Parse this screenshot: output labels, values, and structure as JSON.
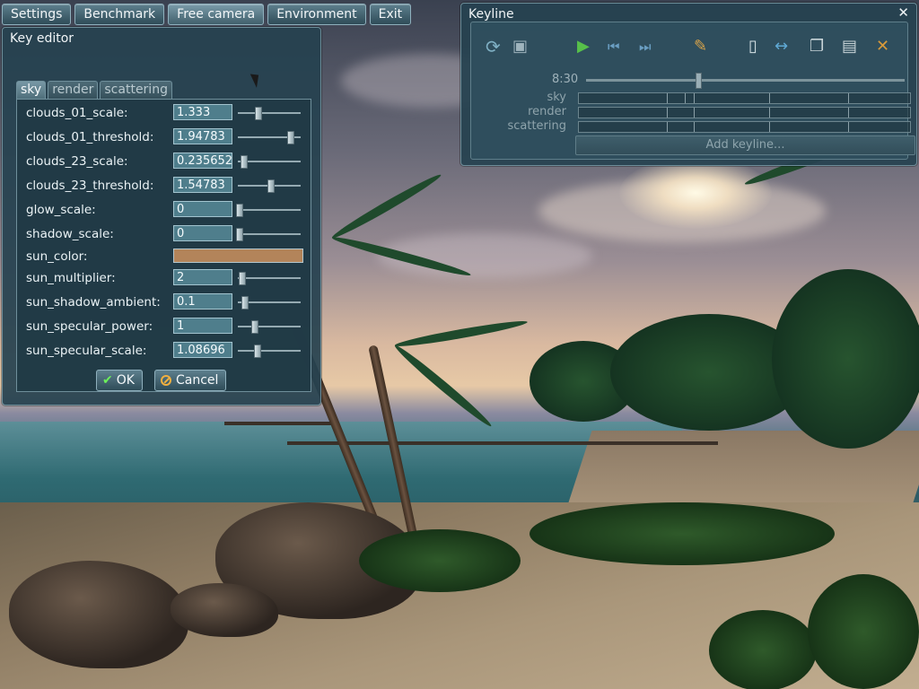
{
  "menu": {
    "items": [
      "Settings",
      "Benchmark",
      "Free camera",
      "Environment",
      "Exit"
    ],
    "active": "Free camera"
  },
  "key_editor": {
    "title": "Key editor",
    "tabs": [
      "sky",
      "render",
      "scattering"
    ],
    "active_tab": "sky",
    "params": [
      {
        "name": "clouds_01_scale:",
        "value": "1.333",
        "slider": 0.32
      },
      {
        "name": "clouds_01_threshold:",
        "value": "1.94783",
        "slider": 0.83
      },
      {
        "name": "clouds_23_scale:",
        "value": "0.235652",
        "slider": 0.08
      },
      {
        "name": "clouds_23_threshold:",
        "value": "1.54783",
        "slider": 0.52
      },
      {
        "name": "glow_scale:",
        "value": "0",
        "slider": 0.02
      },
      {
        "name": "shadow_scale:",
        "value": "0",
        "slider": 0.02
      },
      {
        "name": "sun_color:",
        "color": "#b3845a"
      },
      {
        "name": "sun_multiplier:",
        "value": "2",
        "slider": 0.05
      },
      {
        "name": "sun_shadow_ambient:",
        "value": "0.1",
        "slider": 0.1
      },
      {
        "name": "sun_specular_power:",
        "value": "1",
        "slider": 0.25
      },
      {
        "name": "sun_specular_scale:",
        "value": "1.08696",
        "slider": 0.3
      }
    ],
    "ok_label": "OK",
    "cancel_label": "Cancel"
  },
  "keyline": {
    "title": "Keyline",
    "close_icon": "close-icon",
    "tools": [
      "refresh-icon",
      "save-icon",
      "play-icon",
      "skip-back-icon",
      "skip-forward-icon",
      "pencil-icon",
      "new-document-icon",
      "stretch-icon",
      "copy-icon",
      "paste-icon",
      "delete-icon"
    ],
    "time": "8:30",
    "lanes": [
      "sky",
      "render",
      "scattering"
    ],
    "add_label": "Add keyline..."
  },
  "colors": {
    "panel_bg": "#264250",
    "accent_green": "#6cf05a",
    "accent_orange": "#f0b040"
  }
}
